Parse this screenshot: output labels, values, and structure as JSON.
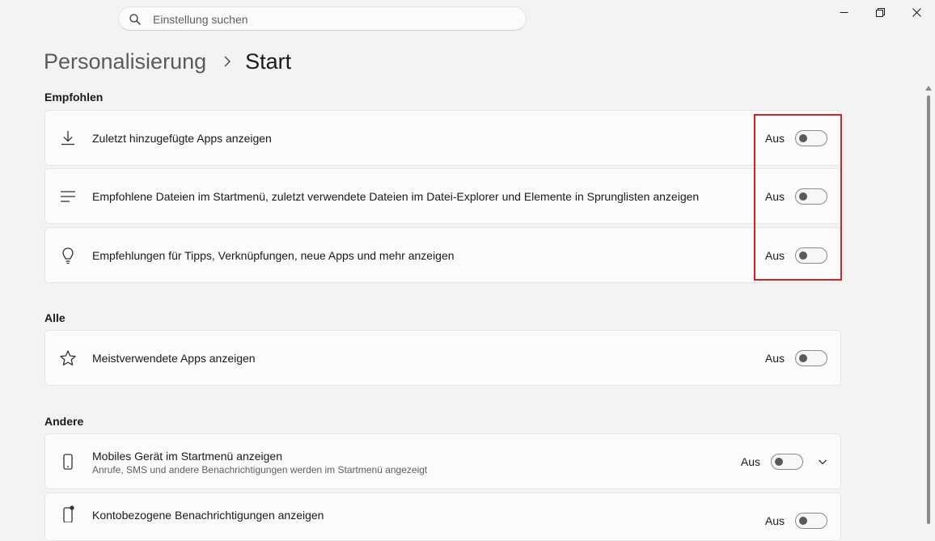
{
  "search": {
    "placeholder": "Einstellung suchen"
  },
  "breadcrumb": {
    "parent": "Personalisierung",
    "current": "Start"
  },
  "sections": {
    "recommended": "Empfohlen",
    "all": "Alle",
    "other": "Andere"
  },
  "settings": {
    "recent_apps": {
      "label": "Zuletzt hinzugefügte Apps anzeigen",
      "state": "Aus",
      "on": false
    },
    "recommended_files": {
      "label": "Empfohlene Dateien im Startmenü, zuletzt verwendete Dateien im Datei-Explorer und Elemente in Sprunglisten anzeigen",
      "state": "Aus",
      "on": false
    },
    "tips": {
      "label": "Empfehlungen für Tipps, Verknüpfungen, neue Apps und mehr anzeigen",
      "state": "Aus",
      "on": false
    },
    "most_used": {
      "label": "Meistverwendete Apps anzeigen",
      "state": "Aus",
      "on": false
    },
    "mobile_device": {
      "label": "Mobiles Gerät im Startmenü anzeigen",
      "sub": "Anrufe, SMS und andere Benachrichtigungen werden im Startmenü angezeigt",
      "state": "Aus",
      "on": false
    },
    "account_notifications": {
      "label": "Kontobezogene Benachrichtigungen anzeigen",
      "state": "Aus",
      "on": false
    }
  },
  "colors": {
    "highlight": "#d6202a",
    "background": "#f3f3f3",
    "card": "#fbfbfb"
  },
  "icons": {
    "search": "search-icon",
    "minimize": "minimize-icon",
    "restore": "restore-icon",
    "close": "close-icon",
    "recent_apps": "download-icon",
    "recommended_files": "list-icon",
    "tips": "lightbulb-icon",
    "most_used": "star-icon",
    "mobile_device": "phone-icon",
    "account_notifications": "phone-notification-icon"
  }
}
